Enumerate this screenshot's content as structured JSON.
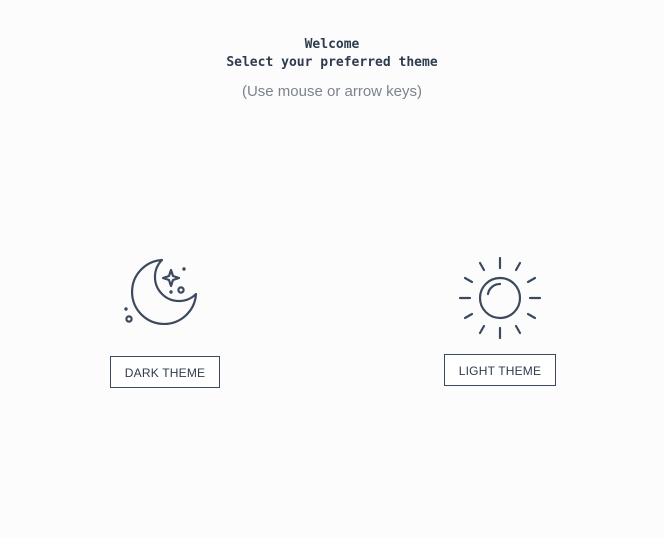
{
  "header": {
    "welcome": "Welcome",
    "subtitle": "Select your preferred theme",
    "hint": "(Use mouse or arrow keys)"
  },
  "options": {
    "dark": {
      "icon": "moon-stars-icon",
      "label": "DARK THEME"
    },
    "light": {
      "icon": "sun-icon",
      "label": "LIGHT THEME"
    }
  },
  "colors": {
    "text": "#2e3b4d",
    "hint": "#7d838c",
    "icon_stroke": "#3c4a5e",
    "background": "#fcfcfc"
  }
}
